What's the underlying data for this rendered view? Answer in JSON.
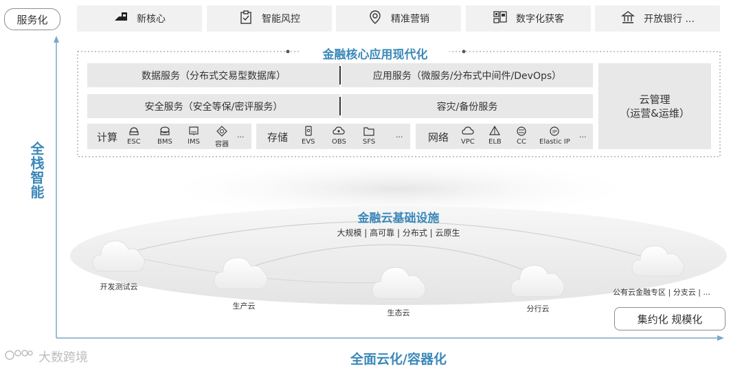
{
  "left_tag": "服务化",
  "top_items": [
    {
      "label": "新核心",
      "icon": "core-icon"
    },
    {
      "label": "智能风控",
      "icon": "clipboard-check-icon"
    },
    {
      "label": "精准营销",
      "icon": "location-pin-icon"
    },
    {
      "label": "数字化获客",
      "icon": "qr-customer-icon"
    },
    {
      "label": "开放银行 ...",
      "icon": "bank-icon"
    }
  ],
  "modern_title": "金融核心应用现代化",
  "row1": {
    "left": "数据服务（分布式交易型数据库）",
    "right": "应用服务（微服务/分布式中间件/DevOps）"
  },
  "row2": {
    "left": "安全服务（安全等保/密评服务）",
    "right": "容灾/备份服务"
  },
  "cloud_mgmt": {
    "line1": "云管理",
    "line2": "（运营&运维）"
  },
  "compute": {
    "title": "计算",
    "items": [
      "ESC",
      "BMS",
      "IMS",
      "容器",
      "..."
    ]
  },
  "storage": {
    "title": "存储",
    "items": [
      "EVS",
      "OBS",
      "SFS",
      "..."
    ]
  },
  "network": {
    "title": "网络",
    "items": [
      "VPC",
      "ELB",
      "CC",
      "Elastic IP",
      "..."
    ]
  },
  "y_axis_label": "全栈智能",
  "infra_title": "金融云基础设施",
  "infra_sub": "大规模 | 高可靠 | 分布式 | 云原生",
  "clouds": [
    "开发测试云",
    "生产云",
    "生态云",
    "分行云",
    "公有云金融专区 | 分支云 | ..."
  ],
  "scale_tag": "集约化 规模化",
  "x_axis_label": "全面云化/容器化",
  "watermark": "大数跨境",
  "colors": {
    "accent": "#3b88b8",
    "tile": "#e8e8e8",
    "card": "#f1f1f1"
  }
}
